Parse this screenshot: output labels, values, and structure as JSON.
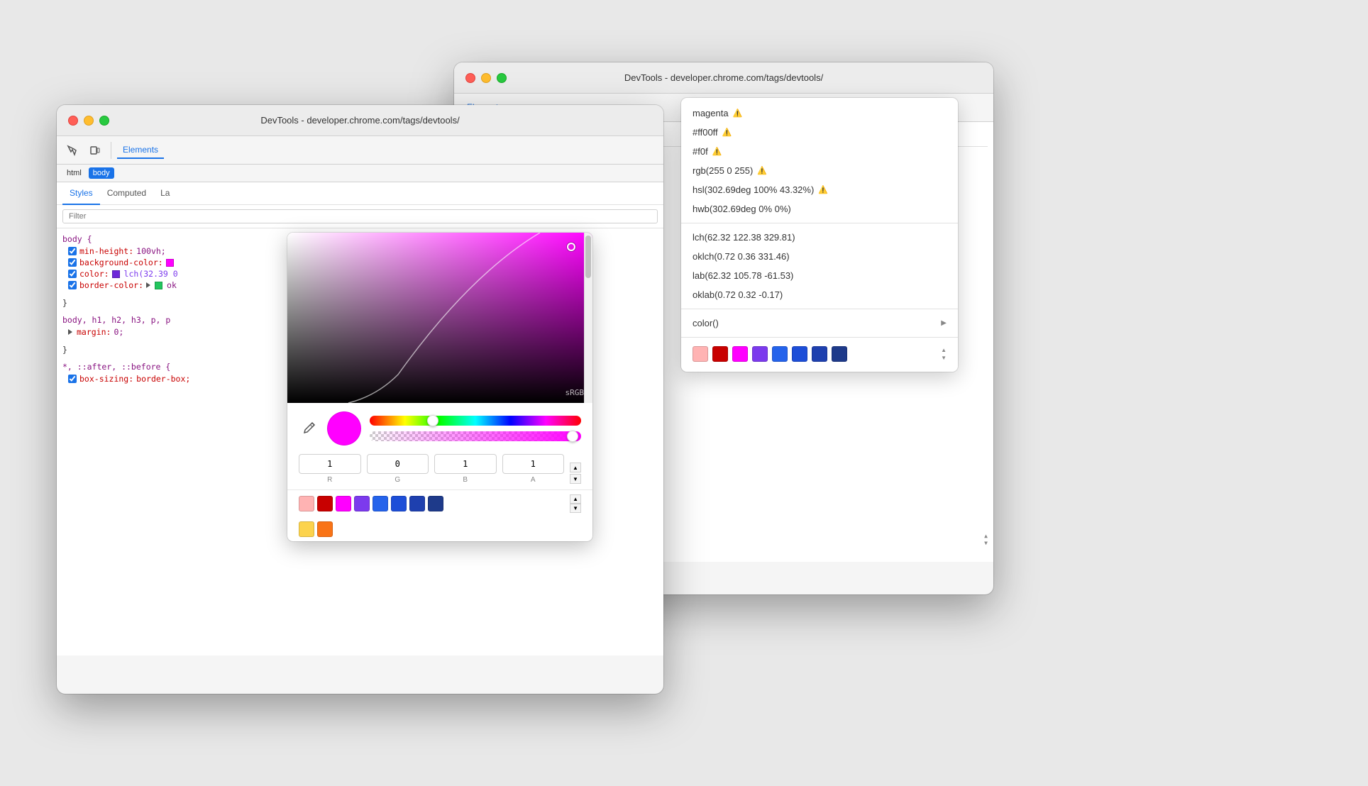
{
  "windows": {
    "back": {
      "title": "DevTools - developer.chrome.com/tags/devtools/",
      "tabs": [
        "Elements"
      ],
      "styles_tabs": [
        "Styles",
        "Computed",
        "La"
      ],
      "css_rules": {
        "body_rule": {
          "selector": "",
          "props": [
            {
              "name": "min-height:",
              "value": "100vh;"
            },
            {
              "name": "background-color:",
              "value": ""
            },
            {
              "name": "color:",
              "value": "lch(32.39 0"
            },
            {
              "name": "border-color:",
              "value": "ok"
            }
          ]
        }
      },
      "color_picker": {
        "srgb_label": "sRGB",
        "channels": {
          "r": {
            "value": "1",
            "label": "R"
          },
          "g": {
            "value": "0",
            "label": "G"
          },
          "b": {
            "value": "1",
            "label": "B"
          },
          "a": {
            "value": "1",
            "label": "A"
          }
        }
      }
    },
    "front": {
      "title": "DevTools - developer.chrome.com/tags/devtools/",
      "toolbar_tabs": [
        "Elements"
      ],
      "breadcrumb": [
        "html",
        "body"
      ],
      "styles_tabs_labels": [
        "Styles",
        "Computed",
        "La"
      ],
      "filter_placeholder": "Filter",
      "css_rules": [
        {
          "selector": "body {",
          "props": [
            {
              "name": "min-height:",
              "value": "100vh;",
              "checked": true,
              "color": null
            },
            {
              "name": "background-color:",
              "value": "",
              "checked": true,
              "color": "magenta"
            },
            {
              "name": "color:",
              "value": "lch(32.39 0",
              "checked": true,
              "color": "purple"
            },
            {
              "name": "border-color:",
              "value": "ok",
              "checked": true,
              "color": "green"
            }
          ],
          "close": "}"
        },
        {
          "selector": "body, h1, h2, h3, p, p",
          "props": [
            {
              "name": "margin:",
              "value": "0;",
              "checked": false,
              "color": null
            }
          ],
          "close": "}"
        },
        {
          "selector": "*, ::after, ::before {",
          "props": [
            {
              "name": "box-sizing:",
              "value": "border-box;",
              "checked": true,
              "color": null
            }
          ]
        }
      ]
    }
  },
  "color_picker": {
    "srgb_label": "sRGB",
    "r_value": "1",
    "g_value": "0",
    "b_value": "1",
    "a_value": "1",
    "r_label": "R",
    "g_label": "G",
    "b_label": "B",
    "a_label": "A",
    "swatches": [
      "#ffb3b3",
      "#c80000",
      "#ff00ff",
      "#7c3aed",
      "#2563eb",
      "#1d4ed8",
      "#1e40af",
      "#1e3a8a"
    ]
  },
  "color_dropdown": {
    "items": [
      {
        "label": "magenta",
        "has_warning": true
      },
      {
        "label": "#ff00ff",
        "has_warning": true
      },
      {
        "label": "#f0f",
        "has_warning": true
      },
      {
        "label": "rgb(255 0 255)",
        "has_warning": true
      },
      {
        "label": "hsl(302.69deg 100% 43.32%)",
        "has_warning": true
      },
      {
        "label": "hwb(302.69deg 0% 0%)",
        "has_warning": false
      },
      {
        "label": "lch(62.32 122.38 329.81)",
        "has_warning": false
      },
      {
        "label": "oklch(0.72 0.36 331.46)",
        "has_warning": false
      },
      {
        "label": "lab(62.32 105.78 -61.53)",
        "has_warning": false
      },
      {
        "label": "oklab(0.72 0.32 -0.17)",
        "has_warning": false
      },
      {
        "label": "color()",
        "has_arrow": true
      }
    ],
    "swatches": [
      "#ffb3b3",
      "#c80000",
      "#ff00ff",
      "#7c3aed",
      "#2563eb",
      "#1d4ed8",
      "#1e40af",
      "#1e3a8a"
    ]
  }
}
